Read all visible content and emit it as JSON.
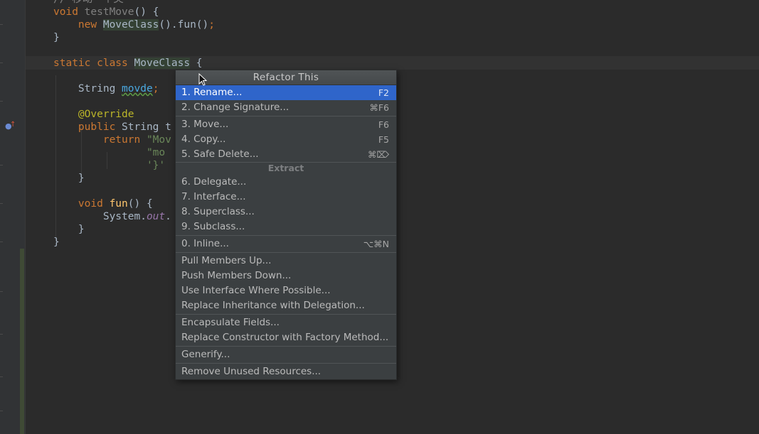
{
  "editor": {
    "code_lines": [
      {
        "parts": [
          {
            "t": "// 移动一个类",
            "c": "cmt"
          }
        ]
      },
      {
        "parts": [
          {
            "t": "void ",
            "c": "kw"
          },
          {
            "t": "testMove",
            "c": "unused"
          },
          {
            "t": "() {",
            "c": ""
          }
        ]
      },
      {
        "parts": [
          {
            "t": "    new ",
            "c": "kw"
          },
          {
            "t": "MoveClass",
            "c": "hl"
          },
          {
            "t": "().fun()",
            "c": ""
          },
          {
            "t": ";",
            "c": "kw"
          }
        ]
      },
      {
        "parts": [
          {
            "t": "}",
            "c": ""
          }
        ]
      },
      {
        "parts": [
          {
            "t": "",
            "c": ""
          }
        ]
      },
      {
        "parts": [
          {
            "t": "static class ",
            "c": "kw"
          },
          {
            "t": "MoveClass",
            "c": "hl"
          },
          {
            "t": " {",
            "c": ""
          }
        ]
      },
      {
        "parts": [
          {
            "t": "",
            "c": ""
          }
        ]
      },
      {
        "parts": [
          {
            "t": "    String ",
            "c": ""
          },
          {
            "t": "movde",
            "c": "typo"
          },
          {
            "t": ";",
            "c": "kw"
          }
        ]
      },
      {
        "parts": [
          {
            "t": "",
            "c": ""
          }
        ]
      },
      {
        "parts": [
          {
            "t": "    @Override",
            "c": "ann"
          }
        ]
      },
      {
        "parts": [
          {
            "t": "    public ",
            "c": "kw"
          },
          {
            "t": "String t",
            "c": ""
          }
        ]
      },
      {
        "parts": [
          {
            "t": "        return ",
            "c": "kw"
          },
          {
            "t": "\"Mov",
            "c": "str"
          }
        ]
      },
      {
        "parts": [
          {
            "t": "               \"mo",
            "c": "str"
          }
        ]
      },
      {
        "parts": [
          {
            "t": "               '}'",
            "c": "str"
          }
        ]
      },
      {
        "parts": [
          {
            "t": "    }",
            "c": ""
          }
        ]
      },
      {
        "parts": [
          {
            "t": "",
            "c": ""
          }
        ]
      },
      {
        "parts": [
          {
            "t": "    void ",
            "c": "kw"
          },
          {
            "t": "fun",
            "c": "fn"
          },
          {
            "t": "() {",
            "c": ""
          }
        ]
      },
      {
        "parts": [
          {
            "t": "        System.",
            "c": ""
          },
          {
            "t": "out",
            "c": "fld"
          },
          {
            "t": ".",
            "c": ""
          }
        ]
      },
      {
        "parts": [
          {
            "t": "    }",
            "c": ""
          }
        ]
      },
      {
        "parts": [
          {
            "t": "}",
            "c": ""
          }
        ]
      }
    ]
  },
  "popup": {
    "title": "Refactor This",
    "group_label": "Extract",
    "items": [
      {
        "label": "1. Rename...",
        "shortcut": "F2",
        "selected": true
      },
      {
        "label": "2. Change Signature...",
        "shortcut": "⌘F6"
      },
      {
        "label": "3. Move...",
        "shortcut": "F6"
      },
      {
        "label": "4. Copy...",
        "shortcut": "F5"
      },
      {
        "label": "5. Safe Delete...",
        "shortcut": "⌘⌦"
      },
      {
        "label": "6. Delegate...",
        "shortcut": ""
      },
      {
        "label": "7. Interface...",
        "shortcut": ""
      },
      {
        "label": "8. Superclass...",
        "shortcut": ""
      },
      {
        "label": "9. Subclass...",
        "shortcut": ""
      },
      {
        "label": "0. Inline...",
        "shortcut": "⌥⌘N"
      },
      {
        "label": "Pull Members Up...",
        "shortcut": ""
      },
      {
        "label": "Push Members Down...",
        "shortcut": ""
      },
      {
        "label": "Use Interface Where Possible...",
        "shortcut": ""
      },
      {
        "label": "Replace Inheritance with Delegation...",
        "shortcut": ""
      },
      {
        "label": "Encapsulate Fields...",
        "shortcut": ""
      },
      {
        "label": "Replace Constructor with Factory Method...",
        "shortcut": ""
      },
      {
        "label": "Generify...",
        "shortcut": ""
      },
      {
        "label": "Remove Unused Resources...",
        "shortcut": ""
      }
    ]
  },
  "icons": {
    "gutter_override": "override-method-icon",
    "pointer": "mouse-pointer-icon"
  }
}
